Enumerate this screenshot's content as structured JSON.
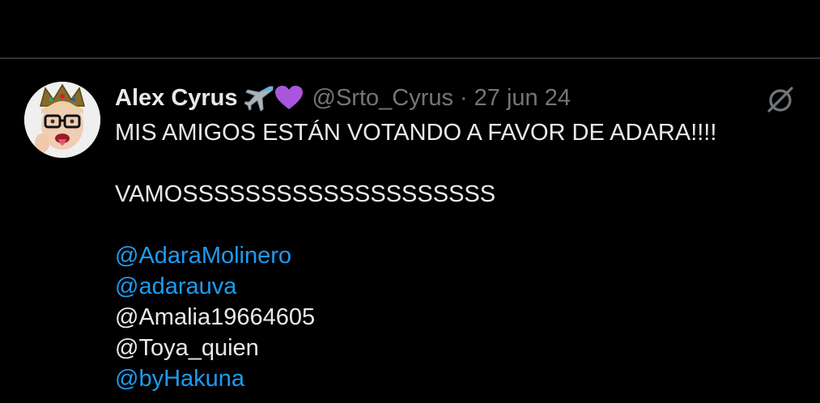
{
  "tweet": {
    "display_name": "Alex Cyrus",
    "name_emojis": [
      "airplane-emoji",
      "purple-heart-emoji"
    ],
    "handle": "@Srto_Cyrus",
    "separator": "·",
    "date": "27 jun 24",
    "text_line_1": "MIS AMIGOS ESTÁN VOTANDO A FAVOR DE ADARA!!!!",
    "text_line_2": "VAMOSSSSSSSSSSSSSSSSSSSS",
    "mentions": [
      {
        "text": "@AdaraMolinero",
        "linked": true
      },
      {
        "text": "@adarauva",
        "linked": true
      },
      {
        "text": "@Amalia19664605",
        "linked": false
      },
      {
        "text": "@Toya_quien",
        "linked": false
      },
      {
        "text": "@byHakuna",
        "linked": true
      }
    ],
    "link_color": "#1d9bf0",
    "text_color": "#e7e9ea",
    "muted_color": "#71767b"
  },
  "icons": {
    "grok": "grok-icon"
  }
}
